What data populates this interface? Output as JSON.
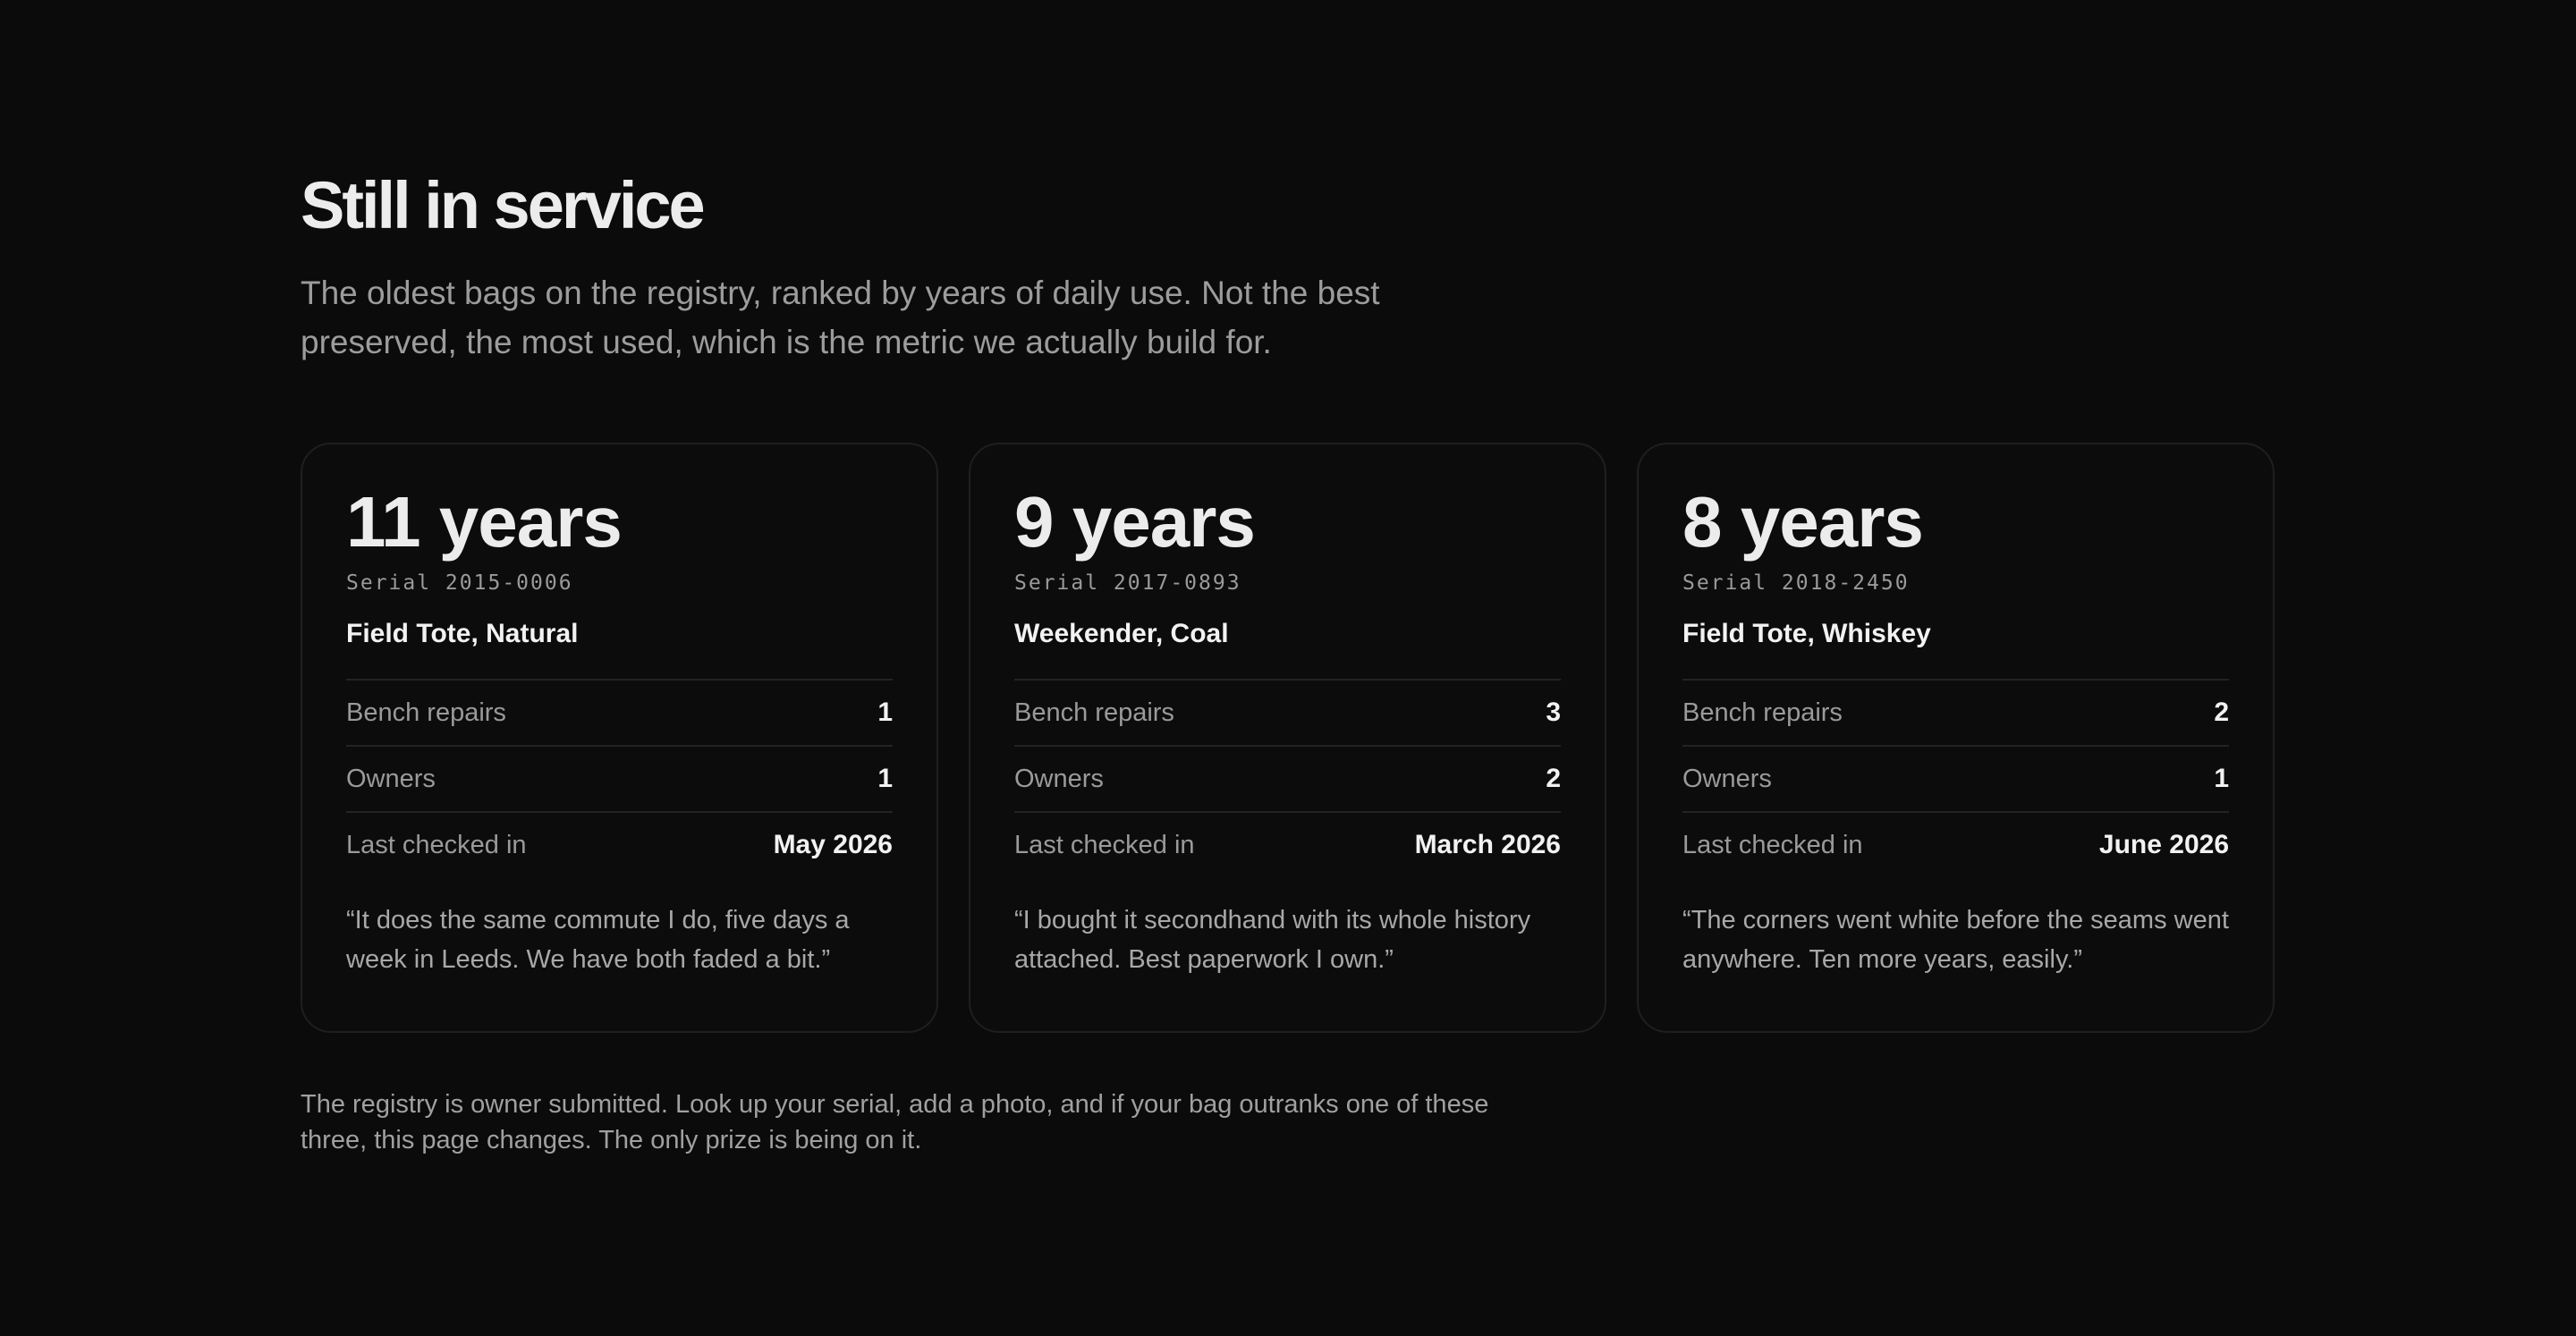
{
  "header": {
    "title": "Still in service",
    "subtitle": "The oldest bags on the registry, ranked by years of daily use. Not the best preserved, the most used, which is the metric we actually build for."
  },
  "cards": [
    {
      "years": "11 years",
      "serial": "Serial 2015-0006",
      "model": "Field Tote, Natural",
      "stats": [
        {
          "label": "Bench repairs",
          "value": "1"
        },
        {
          "label": "Owners",
          "value": "1"
        },
        {
          "label": "Last checked in",
          "value": "May 2026"
        }
      ],
      "quote": "“It does the same commute I do, five days a week in Leeds. We have both faded a bit.”"
    },
    {
      "years": "9 years",
      "serial": "Serial 2017-0893",
      "model": "Weekender, Coal",
      "stats": [
        {
          "label": "Bench repairs",
          "value": "3"
        },
        {
          "label": "Owners",
          "value": "2"
        },
        {
          "label": "Last checked in",
          "value": "March 2026"
        }
      ],
      "quote": "“I bought it secondhand with its whole history attached. Best paperwork I own.”"
    },
    {
      "years": "8 years",
      "serial": "Serial 2018-2450",
      "model": "Field Tote, Whiskey",
      "stats": [
        {
          "label": "Bench repairs",
          "value": "2"
        },
        {
          "label": "Owners",
          "value": "1"
        },
        {
          "label": "Last checked in",
          "value": "June 2026"
        }
      ],
      "quote": "“The corners went white before the seams went anywhere. Ten more years, easily.”"
    }
  ],
  "footnote": "The registry is owner submitted. Look up your serial, add a photo, and if your bag outranks one of these three, this page changes. The only prize is being on it."
}
